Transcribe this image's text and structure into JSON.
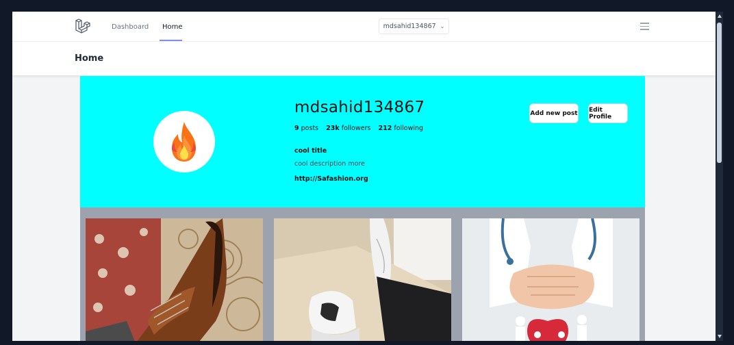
{
  "nav": {
    "links": [
      {
        "label": "Dashboard"
      },
      {
        "label": "Home"
      }
    ],
    "user_dropdown": "mdsahid134867"
  },
  "header": {
    "title": "Home"
  },
  "profile": {
    "username": "mdsahid134867",
    "posts_count": "9",
    "posts_label": "posts",
    "followers_count": "23k",
    "followers_label": "followers",
    "following_count": "212",
    "following_label": "following",
    "bio_title": "cool title",
    "bio_description": "cool description more",
    "bio_link": "http://Safashion.org",
    "add_post_label": "Add new post",
    "edit_profile_label": "Edit Profile",
    "banner_color": "#00ffff",
    "avatar_icon": "fire-icon"
  },
  "posts": [
    {
      "icon": "brown-shoe-photo"
    },
    {
      "icon": "white-sneaker-photo"
    },
    {
      "icon": "doctor-hands-photo"
    }
  ],
  "colors": {
    "accent": "#818cf8",
    "grid_background": "#9ca3af"
  }
}
